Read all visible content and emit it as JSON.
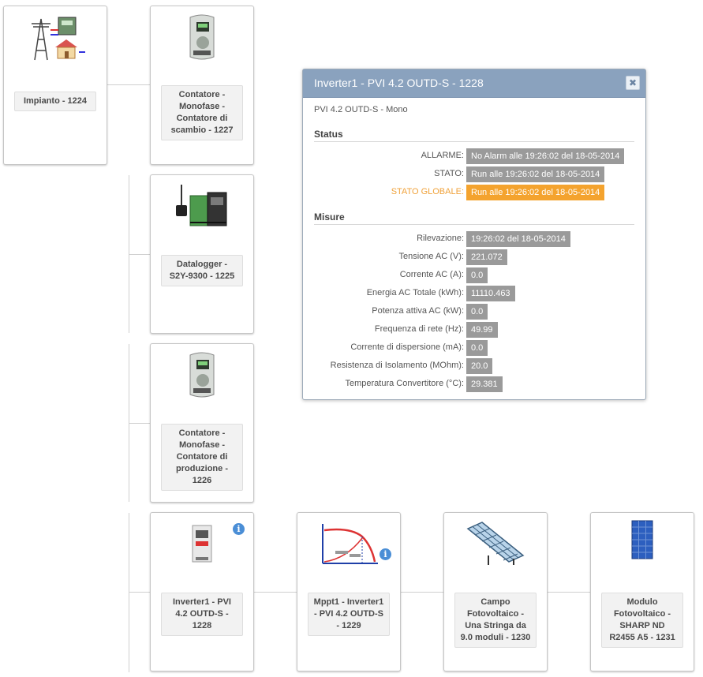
{
  "nodes": {
    "impianto": {
      "label": "Impianto - 1224",
      "icon": "power-grid-house-icon"
    },
    "contatore_scambio": {
      "label": "Contatore - Monofase - Contatore di scambio - 1227",
      "icon": "meter-icon"
    },
    "datalogger": {
      "label": "Datalogger - S2Y-9300 - 1225",
      "icon": "datalogger-icon"
    },
    "contatore_produzione": {
      "label": "Contatore - Monofase - Contatore di produzione - 1226",
      "icon": "meter-icon"
    },
    "inverter": {
      "label": "Inverter1 - PVI 4.2 OUTD-S - 1228",
      "icon": "inverter-icon",
      "info": "i"
    },
    "mppt": {
      "label": "Mppt1 - Inverter1 - PVI 4.2 OUTD-S - 1229",
      "icon": "mppt-chart-icon",
      "info": "i"
    },
    "campo": {
      "label": "Campo Fotovoltaico - Una Stringa da 9.0 moduli - 1230",
      "icon": "solar-array-icon"
    },
    "modulo": {
      "label": "Modulo Fotovoltaico - SHARP ND R2455 A5 - 1231",
      "icon": "solar-panel-icon"
    }
  },
  "popup": {
    "title": "Inverter1 - PVI 4.2 OUTD-S - 1228",
    "close": "✖",
    "subtitle": "PVI 4.2 OUTD-S - Mono",
    "status_title": "Status",
    "status": [
      {
        "key": "ALLARME:",
        "value": "No Alarm alle 19:26:02 del 18-05-2014"
      },
      {
        "key": "STATO:",
        "value": "Run alle 19:26:02 del 18-05-2014"
      },
      {
        "key": "STATO GLOBALE:",
        "value": "Run alle 19:26:02 del 18-05-2014",
        "highlight": "#f4a32e"
      }
    ],
    "misure_title": "Misure",
    "misure": [
      {
        "key": "Rilevazione:",
        "value": "19:26:02 del 18-05-2014"
      },
      {
        "key": "Tensione AC (V):",
        "value": "221.072"
      },
      {
        "key": "Corrente AC (A):",
        "value": "0.0"
      },
      {
        "key": "Energia AC Totale (kWh):",
        "value": "11110.463"
      },
      {
        "key": "Potenza attiva AC (kW):",
        "value": "0.0"
      },
      {
        "key": "Frequenza di rete (Hz):",
        "value": "49.99"
      },
      {
        "key": "Corrente di dispersione (mA):",
        "value": "0.0"
      },
      {
        "key": "Resistenza di Isolamento (MOhm):",
        "value": "20.0"
      },
      {
        "key": "Temperatura Convertitore (°C):",
        "value": "29.381"
      }
    ]
  }
}
